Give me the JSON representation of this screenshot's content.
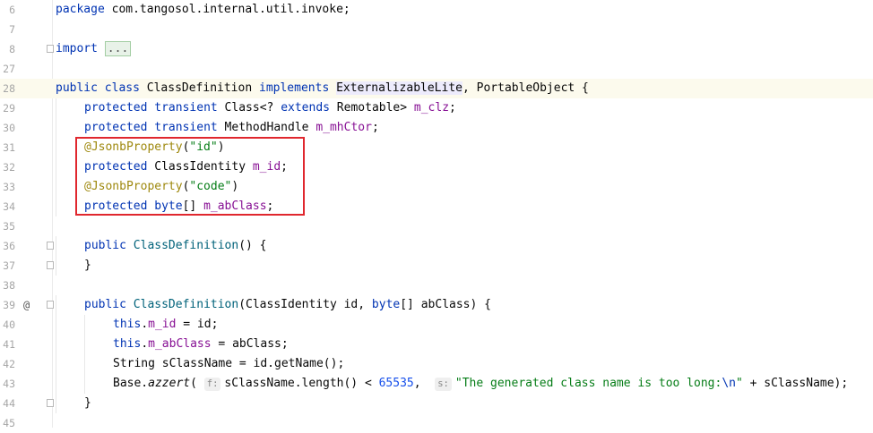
{
  "lines": [
    {
      "num": "6",
      "tokens": [
        {
          "t": "package",
          "c": "kw"
        },
        {
          "t": " com.tangosol.internal.util.invoke;"
        }
      ]
    },
    {
      "num": "7",
      "tokens": []
    },
    {
      "num": "8",
      "tokens": [
        {
          "t": "import",
          "c": "kw"
        },
        {
          "t": " "
        },
        {
          "t": "...",
          "c": "fold-box"
        }
      ],
      "fold": true
    },
    {
      "num": "27",
      "tokens": []
    },
    {
      "num": "28",
      "current": true,
      "tokens": [
        {
          "t": "public",
          "c": "kw"
        },
        {
          "t": " "
        },
        {
          "t": "class",
          "c": "kw"
        },
        {
          "t": " ClassDefinition "
        },
        {
          "t": "implements",
          "c": "kw"
        },
        {
          "t": " "
        },
        {
          "t": "ExternalizableLite",
          "c": "hl"
        },
        {
          "t": ", PortableObject {"
        }
      ]
    },
    {
      "num": "29",
      "indent": 1,
      "tokens": [
        {
          "t": "protected",
          "c": "kw"
        },
        {
          "t": " "
        },
        {
          "t": "transient",
          "c": "kw"
        },
        {
          "t": " Class<? "
        },
        {
          "t": "extends",
          "c": "kw"
        },
        {
          "t": " Remotable> "
        },
        {
          "t": "m_clz",
          "c": "fld"
        },
        {
          "t": ";"
        }
      ]
    },
    {
      "num": "30",
      "indent": 1,
      "tokens": [
        {
          "t": "protected",
          "c": "kw"
        },
        {
          "t": " "
        },
        {
          "t": "transient",
          "c": "kw"
        },
        {
          "t": " MethodHandle "
        },
        {
          "t": "m_mhCtor",
          "c": "fld"
        },
        {
          "t": ";"
        }
      ]
    },
    {
      "num": "31",
      "indent": 1,
      "tokens": [
        {
          "t": "@JsonbProperty",
          "c": "ann"
        },
        {
          "t": "("
        },
        {
          "t": "\"id\"",
          "c": "str"
        },
        {
          "t": ")"
        }
      ]
    },
    {
      "num": "32",
      "indent": 1,
      "tokens": [
        {
          "t": "protected",
          "c": "kw"
        },
        {
          "t": " ClassIdentity "
        },
        {
          "t": "m_id",
          "c": "fld"
        },
        {
          "t": ";"
        }
      ]
    },
    {
      "num": "33",
      "indent": 1,
      "tokens": [
        {
          "t": "@JsonbProperty",
          "c": "ann"
        },
        {
          "t": "("
        },
        {
          "t": "\"code\"",
          "c": "str"
        },
        {
          "t": ")"
        }
      ]
    },
    {
      "num": "34",
      "indent": 1,
      "tokens": [
        {
          "t": "protected",
          "c": "kw"
        },
        {
          "t": " "
        },
        {
          "t": "byte",
          "c": "kw"
        },
        {
          "t": "[] "
        },
        {
          "t": "m_abClass",
          "c": "fld"
        },
        {
          "t": ";"
        }
      ]
    },
    {
      "num": "35",
      "tokens": []
    },
    {
      "num": "36",
      "indent": 1,
      "fold": true,
      "tokens": [
        {
          "t": "public",
          "c": "kw"
        },
        {
          "t": " "
        },
        {
          "t": "ClassDefinition",
          "c": "mth"
        },
        {
          "t": "() {"
        }
      ]
    },
    {
      "num": "37",
      "indent": 1,
      "fold": true,
      "tokens": [
        {
          "t": "}"
        }
      ]
    },
    {
      "num": "38",
      "tokens": []
    },
    {
      "num": "39",
      "indent": 1,
      "fold": true,
      "icon": "@",
      "tokens": [
        {
          "t": "public",
          "c": "kw"
        },
        {
          "t": " "
        },
        {
          "t": "ClassDefinition",
          "c": "mth"
        },
        {
          "t": "(ClassIdentity id, "
        },
        {
          "t": "byte",
          "c": "kw"
        },
        {
          "t": "[] abClass) {"
        }
      ]
    },
    {
      "num": "40",
      "indent": 2,
      "tokens": [
        {
          "t": "this",
          "c": "kw"
        },
        {
          "t": "."
        },
        {
          "t": "m_id",
          "c": "fld"
        },
        {
          "t": " = id;"
        }
      ]
    },
    {
      "num": "41",
      "indent": 2,
      "tokens": [
        {
          "t": "this",
          "c": "kw"
        },
        {
          "t": "."
        },
        {
          "t": "m_abClass",
          "c": "fld"
        },
        {
          "t": " = abClass;"
        }
      ]
    },
    {
      "num": "42",
      "indent": 2,
      "tokens": [
        {
          "t": "String sClassName = id.getName();"
        }
      ]
    },
    {
      "num": "43",
      "indent": 2,
      "tokens": [
        {
          "t": "Base."
        },
        {
          "t": "azzert",
          "c": "ita"
        },
        {
          "t": "( "
        },
        {
          "t": "f:",
          "c": "hint"
        },
        {
          "t": "sClassName.length() < "
        },
        {
          "t": "65535",
          "c": "num"
        },
        {
          "t": ",  "
        },
        {
          "t": "s:",
          "c": "hint"
        },
        {
          "t": "\"The generated class name is too long:",
          "c": "str"
        },
        {
          "t": "\\n",
          "c": "kw"
        },
        {
          "t": "\"",
          "c": "str"
        },
        {
          "t": " + sClassName);"
        }
      ]
    },
    {
      "num": "44",
      "indent": 1,
      "fold": true,
      "tokens": [
        {
          "t": "}"
        }
      ]
    },
    {
      "num": "45",
      "tokens": []
    }
  ]
}
